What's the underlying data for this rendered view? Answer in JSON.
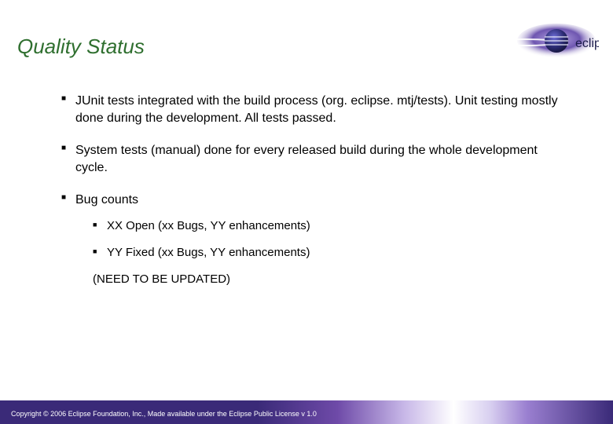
{
  "title": "Quality Status",
  "logo_text": "eclipse",
  "bullets": [
    "JUnit tests integrated with the build process (org. eclipse. mtj/tests). Unit testing mostly done during the development. All tests passed.",
    "System tests (manual) done for every released build during the whole development cycle.",
    "Bug counts"
  ],
  "subbullets": [
    "XX Open (xx Bugs, YY enhancements)",
    "YY Fixed (xx Bugs, YY enhancements)"
  ],
  "note": "(NEED TO BE UPDATED)",
  "footer": "Copyright © 2006 Eclipse Foundation, Inc., Made available under the Eclipse Public License v 1.0"
}
